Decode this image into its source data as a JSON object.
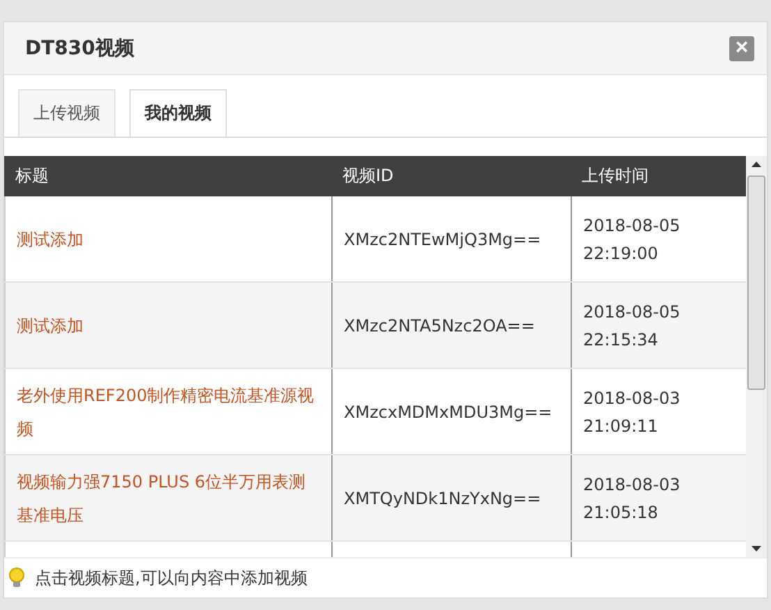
{
  "dialog": {
    "title": "DT830视频",
    "close": "×"
  },
  "tabs": [
    {
      "label": "上传视频",
      "selected": false
    },
    {
      "label": "我的视频",
      "selected": true
    }
  ],
  "table": {
    "columns": [
      "标题",
      "视频ID",
      "上传时间"
    ],
    "rows": [
      {
        "title": "测试添加",
        "video_id": "XMzc2NTEwMjQ3Mg==",
        "date": "2018-08-05",
        "time": "22:19:00"
      },
      {
        "title": "测试添加",
        "video_id": "XMzc2NTA5Nzc2OA==",
        "date": "2018-08-05",
        "time": "22:15:34"
      },
      {
        "title": "老外使用REF200制作精密电流基准源视频",
        "video_id": "XMzcxMDMxMDU3Mg==",
        "date": "2018-08-03",
        "time": "21:09:11"
      },
      {
        "title": "视频输力强7150 PLUS 6位半万用表测基准电压",
        "video_id": "XMTQyNDk1NzYxNg==",
        "date": "2018-08-03",
        "time": "21:05:18"
      }
    ]
  },
  "hint": "点击视频标题,可以向内容中添加视频"
}
